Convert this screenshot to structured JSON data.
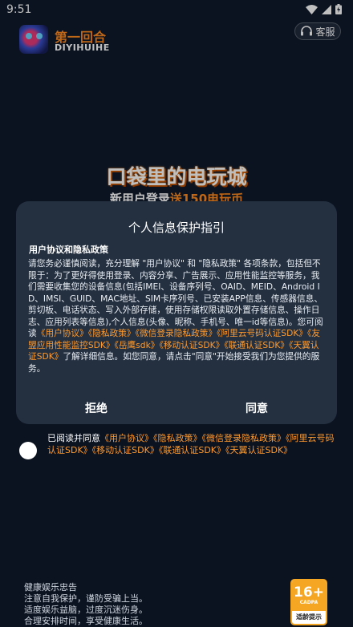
{
  "status_bar": {
    "time": "9:51"
  },
  "header": {
    "app_name_cn": "第一回合",
    "app_name_en": "DIYIHUIHE",
    "service_label": "客服"
  },
  "banner": {
    "title": "口袋里的电玩城",
    "subtitle_prefix": "新用户登录",
    "subtitle_highlight": "送150电玩币"
  },
  "dialog": {
    "title": "个人信息保护指引",
    "heading": "用户协议和隐私政策",
    "body_intro": "请您务必谨慎阅读，充分理解 \"用户协议\" 和 \"隐私政策\" 各项条款，包括但不限于：为了更好得使用登录、内容分享、广告展示、应用性能监控等服务，我们需要收集您的设备信息(包括IMEI、设备序列号、OAID、MEID、Android ID、IMSI、GUID、MAC地址、SIM卡序列号、已安装APP信息、传感器信息、剪切板、电话状态、写入外部存储，使用存储权限读取外置存储信息、操作日志、应用列表等信息),个人信息(头像、昵称、手机号、唯一id等信息)。您可阅读",
    "links": [
      "《用户协议》",
      "《隐私政策》",
      "《微信登录隐私政策》",
      "《阿里云号码认证SDK》",
      "《友盟应用性能监控SDK》",
      "《岳鹰sdk》",
      "《移动认证SDK》",
      "《联通认证SDK》",
      "《天翼认证SDK》"
    ],
    "body_outro": "了解详细信息。如您同意，请点击\"同意\"开始接受我们为您提供的服务。",
    "reject_label": "拒绝",
    "agree_label": "同意"
  },
  "agreement": {
    "prefix": "已阅读并同意",
    "links": [
      "《用户协议》",
      "《隐私政策》",
      "《微信登录隐私政策》",
      "《阿里云号码认证SDK》",
      "《移动认证SDK》",
      "《联通认证SDK》",
      "《天翼认证SDK》"
    ]
  },
  "health_notice": {
    "title": "健康娱乐忠告",
    "lines": [
      "注意自我保护，谨防受骗上当。",
      "适度娱乐益脑，过度沉迷伤身。",
      "合理安排时间，享受健康生活。"
    ]
  },
  "age_rating": {
    "age": "16+",
    "org": "CADPA",
    "caption": "适龄提示"
  },
  "colors": {
    "background": "#0f1a2c",
    "dialog": "#243040",
    "accent": "#ff9b2e"
  }
}
